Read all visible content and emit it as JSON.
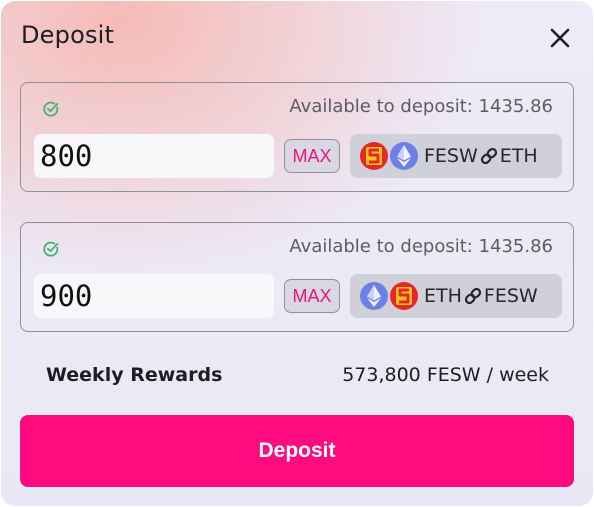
{
  "header": {
    "title": "Deposit",
    "close_icon": "close-icon"
  },
  "inputs": [
    {
      "status_icon": "check-circle-icon",
      "available_label": "Available to deposit: 1435.86",
      "amount": "800",
      "max_label": "MAX",
      "tokens": [
        "fesw-token-icon",
        "eth-token-icon"
      ],
      "pair_left": "FESW",
      "pair_right": "ETH",
      "link_icon": "link-icon"
    },
    {
      "status_icon": "check-circle-icon",
      "available_label": "Available to deposit: 1435.86",
      "amount": "900",
      "max_label": "MAX",
      "tokens": [
        "eth-token-icon",
        "fesw-token-icon"
      ],
      "pair_left": "ETH",
      "pair_right": "FESW",
      "link_icon": "link-icon"
    }
  ],
  "rewards": {
    "label": "Weekly Rewards",
    "value": "573,800 FESW / week"
  },
  "actions": {
    "deposit_label": "Deposit"
  },
  "colors": {
    "accent": "#ff0a7f",
    "max_text": "#e8157e",
    "check": "#3cb36b",
    "fesw_red": "#e8262a",
    "fesw_yellow": "#f7c61a",
    "eth_blue": "#6b7fe8"
  }
}
